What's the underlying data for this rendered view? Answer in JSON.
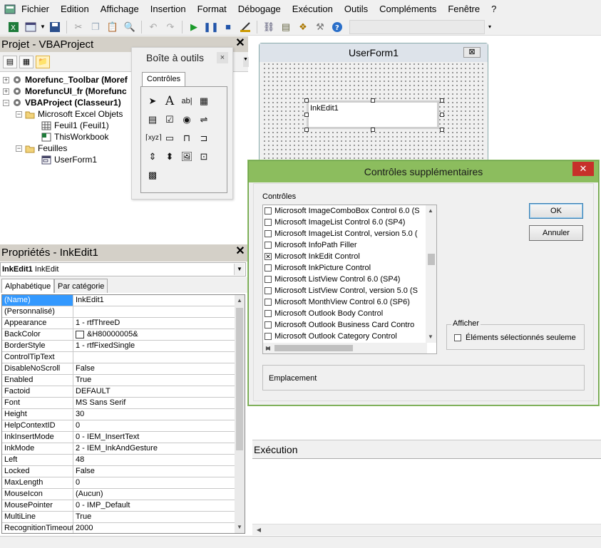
{
  "menu": [
    "Fichier",
    "Edition",
    "Affichage",
    "Insertion",
    "Format",
    "Débogage",
    "Exécution",
    "Outils",
    "Compléments",
    "Fenêtre",
    "?"
  ],
  "project": {
    "title": "Projet - VBAProject",
    "close": "✕",
    "tree": [
      {
        "label": "Morefunc_Toolbar (Moref",
        "bold": true
      },
      {
        "label": "MorefuncUI_fr (Morefunc",
        "bold": true
      },
      {
        "label": "VBAProject (Classeur1)",
        "bold": true
      },
      {
        "label": "Microsoft Excel Objets"
      },
      {
        "label": "Feuil1 (Feuil1)"
      },
      {
        "label": "ThisWorkbook"
      },
      {
        "label": "Feuilles"
      },
      {
        "label": "UserForm1"
      }
    ]
  },
  "toolbox": {
    "title": "Boîte à outils",
    "close": "×",
    "tab": "Contrôles"
  },
  "userform": {
    "title": "UserForm1",
    "close": "⊠",
    "control_text": "InkEdit1"
  },
  "properties": {
    "title": "Propriétés - InkEdit1",
    "close": "✕",
    "combo_name": "InkEdit1",
    "combo_type": "InkEdit",
    "tabs": [
      "Alphabétique",
      "Par catégorie"
    ],
    "rows": [
      {
        "k": "(Name)",
        "v": "InkEdit1"
      },
      {
        "k": "(Personnalisé)",
        "v": ""
      },
      {
        "k": "Appearance",
        "v": "1 - rtfThreeD"
      },
      {
        "k": "BackColor",
        "v": "&H80000005&"
      },
      {
        "k": "BorderStyle",
        "v": "1 - rtfFixedSingle"
      },
      {
        "k": "ControlTipText",
        "v": ""
      },
      {
        "k": "DisableNoScroll",
        "v": "False"
      },
      {
        "k": "Enabled",
        "v": "True"
      },
      {
        "k": "Factoid",
        "v": "DEFAULT"
      },
      {
        "k": "Font",
        "v": "MS Sans Serif"
      },
      {
        "k": "Height",
        "v": "30"
      },
      {
        "k": "HelpContextID",
        "v": "0"
      },
      {
        "k": "InkInsertMode",
        "v": "0 - IEM_InsertText"
      },
      {
        "k": "InkMode",
        "v": "2 - IEM_InkAndGesture"
      },
      {
        "k": "Left",
        "v": "48"
      },
      {
        "k": "Locked",
        "v": "False"
      },
      {
        "k": "MaxLength",
        "v": "0"
      },
      {
        "k": "MouseIcon",
        "v": "(Aucun)"
      },
      {
        "k": "MousePointer",
        "v": "0 - IMP_Default"
      },
      {
        "k": "MultiLine",
        "v": "True"
      },
      {
        "k": "RecognitionTimeout",
        "v": "2000"
      }
    ]
  },
  "dialog": {
    "title": "Contrôles supplémentaires",
    "close": "✕",
    "list_label": "Contrôles",
    "items": [
      {
        "label": "Microsoft ImageComboBox Control 6.0 (S",
        "checked": false
      },
      {
        "label": "Microsoft ImageList Control 6.0 (SP4)",
        "checked": false
      },
      {
        "label": "Microsoft ImageList Control, version 5.0 (",
        "checked": false
      },
      {
        "label": "Microsoft InfoPath Filler",
        "checked": false
      },
      {
        "label": "Microsoft InkEdit Control",
        "checked": true
      },
      {
        "label": "Microsoft InkPicture Control",
        "checked": false
      },
      {
        "label": "Microsoft ListView Control 6.0 (SP4)",
        "checked": false
      },
      {
        "label": "Microsoft ListView Control, version 5.0 (S",
        "checked": false
      },
      {
        "label": "Microsoft MonthView Control 6.0 (SP6)",
        "checked": false
      },
      {
        "label": "Microsoft Outlook Body Control",
        "checked": false
      },
      {
        "label": "Microsoft Outlook Business Card Contro",
        "checked": false
      },
      {
        "label": "Microsoft Outlook Category Control",
        "checked": false
      }
    ],
    "ok": "OK",
    "cancel": "Annuler",
    "show_group": "Afficher",
    "show_selected": "Éléments sélectionnés seuleme",
    "location_label": "Emplacement"
  },
  "execution": {
    "title": "Exécution"
  }
}
